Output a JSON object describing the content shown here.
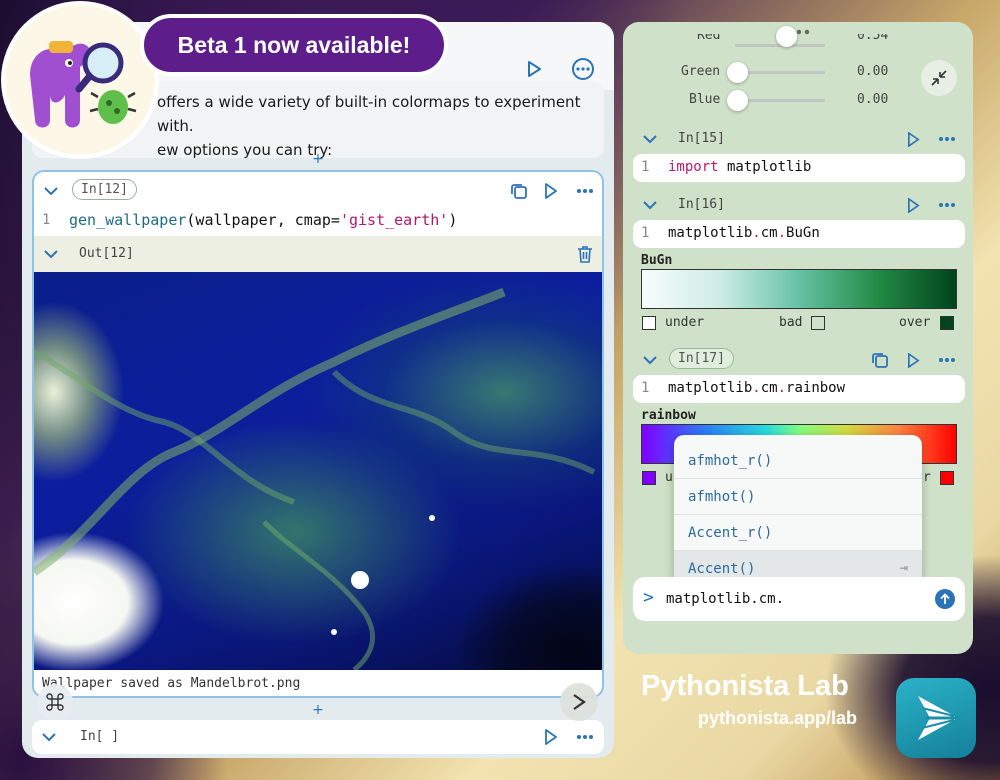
{
  "badge": {
    "text": "Beta 1 now available!"
  },
  "brand": {
    "title": "Pythonista Lab",
    "url": "pythonista.app/lab"
  },
  "left": {
    "markdown": {
      "line1": "offers a wide variety of built-in colormaps to experiment with.",
      "line2": "ew options you can try:"
    },
    "cell12": {
      "prompt": "In[12]",
      "line_no": "1",
      "code_func": "gen_wallpaper",
      "code_args": "(wallpaper, cmap=",
      "code_str": "'gist_earth'",
      "code_close": ")"
    },
    "out12": {
      "prompt": "Out[12]",
      "saved": "Wallpaper saved as Mandelbrot.png"
    },
    "empty_cell": {
      "prompt": "In[ ]"
    },
    "add_symbol": "+"
  },
  "right": {
    "sliders": [
      {
        "label": "Red",
        "value": "0.54",
        "fraction": 0.54
      },
      {
        "label": "Green",
        "value": "0.00",
        "fraction": 0.0
      },
      {
        "label": "Blue",
        "value": "0.00",
        "fraction": 0.0
      }
    ],
    "cell15": {
      "prompt": "In[15]",
      "line_no": "1",
      "kw": "import",
      "mod": " matplotlib"
    },
    "cell16": {
      "prompt": "In[16]",
      "line_no": "1",
      "a": "matplotlib",
      "b": "cm",
      "c": "BuGn"
    },
    "bugn": {
      "name": "BuGn",
      "under": "under",
      "bad": "bad",
      "over": "over",
      "under_color": "#ffffff",
      "over_color": "#00441b"
    },
    "cell17": {
      "prompt": "In[17]",
      "line_no": "1",
      "a": "matplotlib",
      "b": "cm",
      "c": "rainbow"
    },
    "rainbow": {
      "name": "rainbow",
      "under_prefix": "u",
      "over_suffix": "r",
      "under_color": "#7f00ff",
      "over_color": "#ff0000"
    },
    "autocomplete": [
      "afmhot_r()",
      "afmhot()",
      "Accent_r()",
      "Accent()"
    ],
    "input": {
      "prompt": ">",
      "text": "matplotlib.cm."
    }
  },
  "colors": {
    "accent": "#2b73b8",
    "badge": "#5d1e8c",
    "keyword": "#c0186b",
    "string": "#b3156e"
  }
}
